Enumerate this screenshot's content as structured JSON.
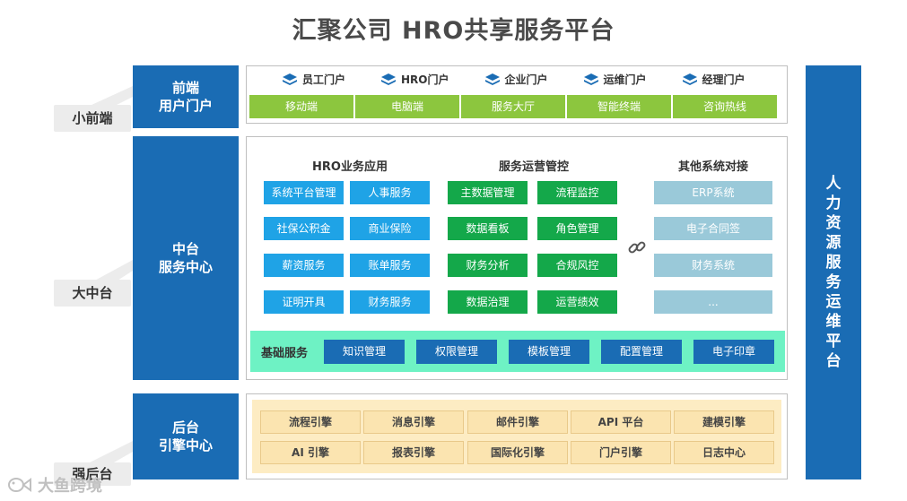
{
  "title": "汇聚公司  HRO共享服务平台",
  "layers": {
    "front": {
      "line1": "前端",
      "line2": "用户门户",
      "tag": "小前端"
    },
    "middle": {
      "line1": "中台",
      "line2": "服务中心",
      "tag": "大中台"
    },
    "back": {
      "line1": "后台",
      "line2": "引擎中心",
      "tag": "强后台"
    }
  },
  "right_bar": [
    "人",
    "力",
    "资",
    "源",
    "服",
    "务",
    "运",
    "维",
    "平",
    "台"
  ],
  "portals": [
    "员工门户",
    "HRO门户",
    "企业门户",
    "运维门户",
    "经理门户"
  ],
  "channels": [
    "移动端",
    "电脑端",
    "服务大厅",
    "智能终端",
    "咨询热线"
  ],
  "middle": {
    "col1_title": "HRO业务应用",
    "col1": [
      "系统平台管理",
      "人事服务",
      "社保公积金",
      "商业保险",
      "薪资服务",
      "账单服务",
      "证明开具",
      "财务服务"
    ],
    "col2_title": "服务运营管控",
    "col2": [
      "主数据管理",
      "流程监控",
      "数据看板",
      "角色管理",
      "财务分析",
      "合规风控",
      "数据治理",
      "运营绩效"
    ],
    "col3_title": "其他系统对接",
    "col3": [
      "ERP系统",
      "电子合同签",
      "财务系统",
      "..."
    ],
    "base_label": "基础服务",
    "base": [
      "知识管理",
      "权限管理",
      "模板管理",
      "配置管理",
      "电子印章"
    ]
  },
  "engines": [
    "流程引擎",
    "消息引擎",
    "邮件引擎",
    "API 平台",
    "建模引擎",
    "AI 引擎",
    "报表引擎",
    "国际化引擎",
    "门户引擎",
    "日志中心"
  ],
  "watermark": "大鱼跨境",
  "colors": {
    "primary": "#1a6cb4",
    "channel": "#8cc63e",
    "blue": "#1fa3e6",
    "green": "#14a84a",
    "gray": "#9ac9d9",
    "base": "#6ef2c4",
    "engine": "#fbe4b0"
  }
}
